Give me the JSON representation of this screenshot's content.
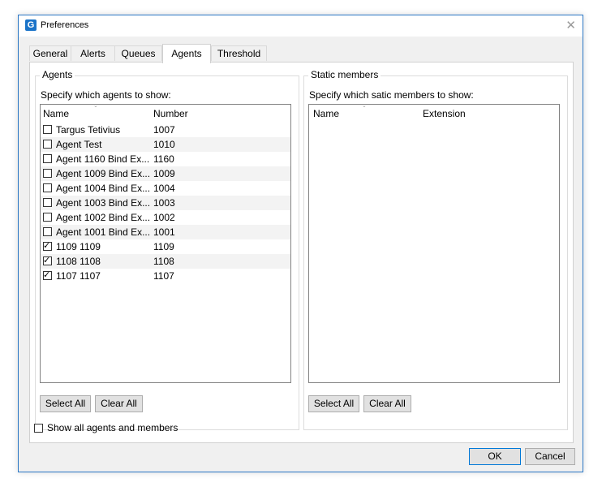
{
  "window": {
    "title": "Preferences",
    "app_icon_letter": "G",
    "close_glyph": "✕"
  },
  "tabs": [
    {
      "label": "General",
      "active": false
    },
    {
      "label": "Alerts",
      "active": false
    },
    {
      "label": "Queues",
      "active": false
    },
    {
      "label": "Agents",
      "active": true
    },
    {
      "label": "Threshold",
      "active": false
    }
  ],
  "agents": {
    "group_title": "Agents",
    "description": "Specify which agents to show:",
    "columns": {
      "name": "Name",
      "number": "Number"
    },
    "rows": [
      {
        "name": "Targus Tetivius",
        "number": "1007",
        "checked": false
      },
      {
        "name": "Agent Test",
        "number": "1010",
        "checked": false
      },
      {
        "name": "Agent 1160 Bind Ex...",
        "number": "1160",
        "checked": false
      },
      {
        "name": "Agent 1009 Bind Ex...",
        "number": "1009",
        "checked": false
      },
      {
        "name": "Agent 1004 Bind Ex...",
        "number": "1004",
        "checked": false
      },
      {
        "name": "Agent 1003 Bind Ex...",
        "number": "1003",
        "checked": false
      },
      {
        "name": "Agent 1002 Bind Ex...",
        "number": "1002",
        "checked": false
      },
      {
        "name": "Agent 1001 Bind Ex...",
        "number": "1001",
        "checked": false
      },
      {
        "name": "1109 1109",
        "number": "1109",
        "checked": true
      },
      {
        "name": "1108 1108",
        "number": "1108",
        "checked": true
      },
      {
        "name": "1107 1107",
        "number": "1107",
        "checked": true
      }
    ],
    "select_all": "Select All",
    "clear_all": "Clear All"
  },
  "static_members": {
    "group_title": "Static members",
    "description": "Specify which satic members to show:",
    "columns": {
      "name": "Name",
      "extension": "Extension"
    },
    "rows": [],
    "select_all": "Select All",
    "clear_all": "Clear All"
  },
  "show_all": {
    "label": "Show all agents and members",
    "checked": false
  },
  "footer": {
    "ok": "OK",
    "cancel": "Cancel"
  },
  "icons": {
    "checkmark": "✓",
    "sort_caret": "⌄"
  }
}
